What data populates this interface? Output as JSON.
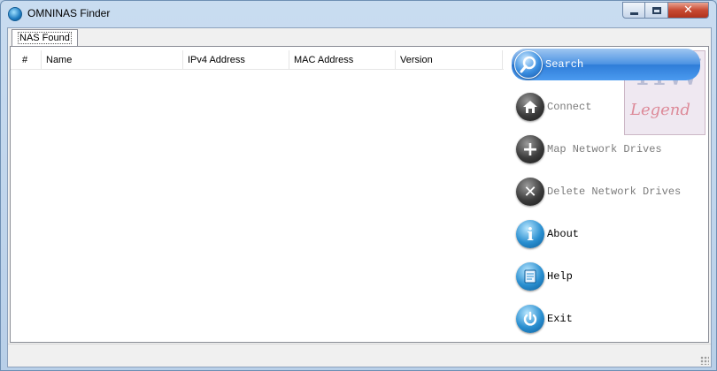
{
  "window": {
    "title": "OMNINAS Finder"
  },
  "tabs": [
    {
      "label": "NAS Found"
    }
  ],
  "table": {
    "columns": [
      "#",
      "Name",
      "IPv4 Address",
      "MAC Address",
      "Version"
    ],
    "rows": []
  },
  "actions": [
    {
      "label": "Search",
      "icon": "search-icon",
      "state": "active"
    },
    {
      "label": "Connect",
      "icon": "home-icon",
      "state": "disabled"
    },
    {
      "label": "Map Network Drives",
      "icon": "plus-icon",
      "state": "disabled"
    },
    {
      "label": "Delete Network Drives",
      "icon": "x-icon",
      "state": "disabled"
    },
    {
      "label": "About",
      "icon": "info-icon",
      "state": "enabled"
    },
    {
      "label": "Help",
      "icon": "book-icon",
      "state": "enabled"
    },
    {
      "label": "Exit",
      "icon": "power-icon",
      "state": "enabled"
    }
  ],
  "logo": {
    "top_text": "HW",
    "bottom_text": "Legend"
  },
  "colors": {
    "accent": "#2f7dd8",
    "close": "#c84a32"
  }
}
